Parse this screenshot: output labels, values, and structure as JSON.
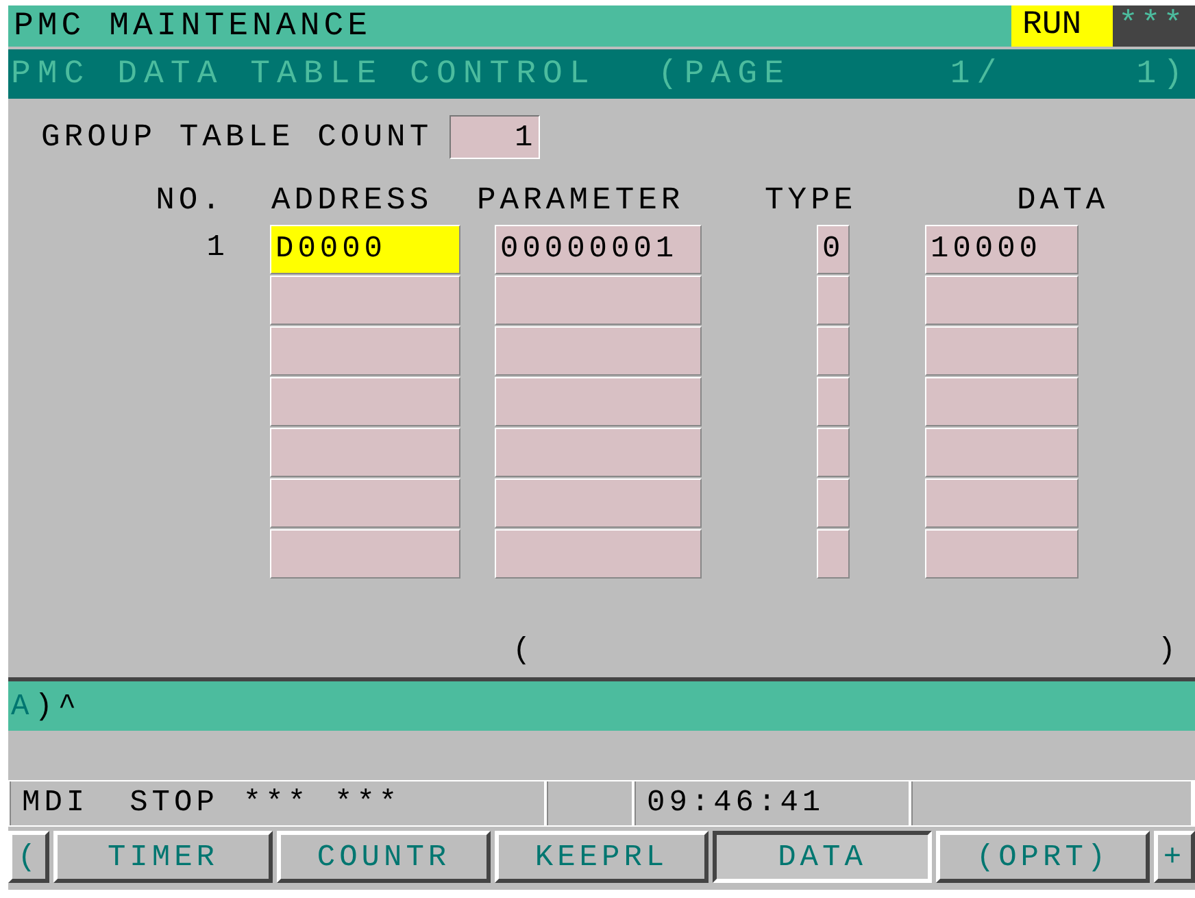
{
  "header": {
    "title": "PMC MAINTENANCE",
    "mode": "RUN",
    "alarm": "***"
  },
  "subheader": {
    "title": "PMC DATA TABLE CONTROL",
    "page": "(PAGE      1/     1)"
  },
  "group_table_count": {
    "label": "GROUP TABLE COUNT",
    "value": "1"
  },
  "table": {
    "columns": [
      "NO.",
      "ADDRESS",
      "PARAMETER",
      "TYPE",
      "DATA"
    ],
    "rows": [
      {
        "no": "1",
        "address": "D0000",
        "parameter": "00000001",
        "type": "0",
        "data": "10000",
        "selected": true
      },
      {
        "selected": false
      },
      {
        "selected": false
      },
      {
        "selected": false
      },
      {
        "selected": false
      },
      {
        "selected": false
      },
      {
        "selected": false
      }
    ]
  },
  "input_brackets": {
    "open": "(",
    "close": ")"
  },
  "key_input": {
    "prompt": "A",
    "separator": ")",
    "cursor": "^"
  },
  "status_bar": {
    "mode": "MDI",
    "state": "STOP",
    "field_1": "***",
    "field_2": "***",
    "time": "09:46:41"
  },
  "soft_keys": [
    {
      "label": "(",
      "kind": "arrow",
      "selected": false
    },
    {
      "label": "TIMER",
      "kind": "key",
      "selected": false
    },
    {
      "label": "COUNTR",
      "kind": "key",
      "selected": false
    },
    {
      "label": "KEEPRL",
      "kind": "key",
      "selected": false
    },
    {
      "label": "DATA",
      "kind": "key",
      "selected": true
    },
    {
      "label": "(OPRT)",
      "kind": "key",
      "selected": false
    },
    {
      "label": "+",
      "kind": "arrow",
      "selected": false
    }
  ]
}
